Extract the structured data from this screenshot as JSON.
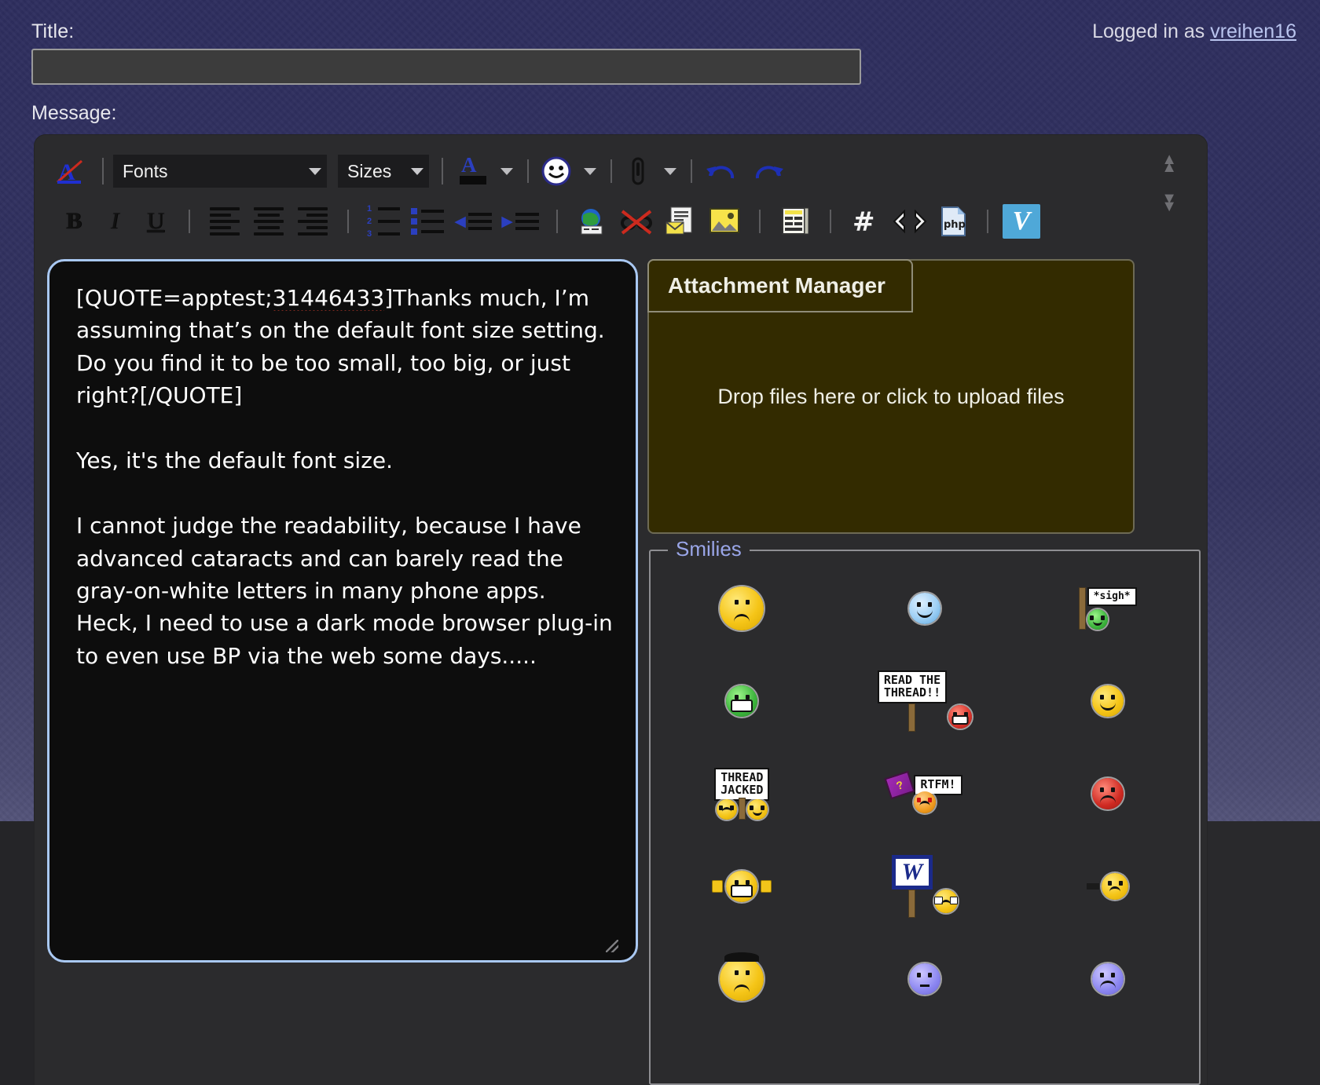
{
  "header": {
    "title_label": "Title:",
    "message_label": "Message:",
    "title_value": "",
    "title_placeholder": "",
    "logged_in_prefix": "Logged in as ",
    "username": "vreihen16"
  },
  "toolbar": {
    "row1": {
      "remove_format": "remove-formatting",
      "fonts_label": "Fonts",
      "sizes_label": "Sizes",
      "font_color": "A",
      "smiley": "smiley",
      "attach": "paperclip",
      "undo": "undo",
      "redo": "redo"
    },
    "row2": {
      "bold": "B",
      "italic": "I",
      "underline": "U",
      "align_left": "align-left",
      "align_center": "align-center",
      "align_right": "align-right",
      "ordered_list": "ordered-list",
      "unordered_list": "unordered-list",
      "outdent": "outdent",
      "indent": "indent",
      "link": "link",
      "unlink": "unlink",
      "email": "email",
      "image": "image",
      "quote": "quote",
      "hash": "hash",
      "code": "code",
      "php": "php",
      "video": "V"
    },
    "collapse_up": "collapse-up",
    "collapse_down": "collapse-down"
  },
  "message": {
    "quote_open": "[QUOTE=apptest;",
    "quote_id": "31446433",
    "quote_close": "]",
    "quoted_text": "Thanks much, I’m assuming that’s on the default font size setting.  Do you find it to be too small, too big, or just right?[/QUOTE]",
    "body": "\n\nYes, it's the default font size.\n\nI cannot judge the readability, because I have advanced cataracts and can barely read the gray-on-white letters in many phone apps.  Heck, I need to use a dark mode browser plug-in to even use BP via the web some days....."
  },
  "attachment": {
    "header": "Attachment Manager",
    "drop_text": "Drop files here or click to upload files"
  },
  "smilies": {
    "legend": "Smilies",
    "items": [
      {
        "name": "facepalm",
        "kind": "face",
        "color": "yellow",
        "mouth": "frown",
        "sign": ""
      },
      {
        "name": "cool-blue",
        "kind": "face",
        "color": "blue",
        "mouth": "smile",
        "sign": ""
      },
      {
        "name": "sigh",
        "kind": "sign-face",
        "color": "green",
        "mouth": "smile",
        "sign": "*sigh*"
      },
      {
        "name": "big-grin-green",
        "kind": "face",
        "color": "green",
        "mouth": "teeth",
        "sign": ""
      },
      {
        "name": "read-the-thread",
        "kind": "sign-face",
        "color": "red",
        "mouth": "teeth",
        "sign": "READ THE\nTHREAD!!"
      },
      {
        "name": "smile-yellow",
        "kind": "face",
        "color": "yellow",
        "mouth": "smile",
        "sign": ""
      },
      {
        "name": "thread-jacked",
        "kind": "sign-face",
        "color": "yellow",
        "mouth": "frown",
        "sign": "THREAD\nJACKED"
      },
      {
        "name": "rtfm",
        "kind": "sign-face",
        "color": "orange",
        "mouth": "frown",
        "sign": "RTFM!"
      },
      {
        "name": "stop-red",
        "kind": "face",
        "color": "redsq",
        "mouth": "frown",
        "sign": ""
      },
      {
        "name": "applause",
        "kind": "face",
        "color": "yellow",
        "mouth": "teeth",
        "sign": ""
      },
      {
        "name": "whatever-w",
        "kind": "sign-face",
        "color": "yellow",
        "mouth": "frown",
        "sign": "W"
      },
      {
        "name": "hammer-yellow",
        "kind": "face",
        "color": "yellow",
        "mouth": "frown",
        "sign": ""
      },
      {
        "name": "angry-yellow",
        "kind": "face",
        "color": "yellow",
        "mouth": "frown",
        "sign": ""
      },
      {
        "name": "blank-purple",
        "kind": "face",
        "color": "purple",
        "mouth": "flat",
        "sign": ""
      },
      {
        "name": "sad-purple",
        "kind": "face",
        "color": "purple",
        "mouth": "frown",
        "sign": ""
      }
    ]
  },
  "colors": {
    "accent_link": "#b9c4ee",
    "focus_border": "#a9c8f2",
    "attachment_bg": "#332b00",
    "toolbar_bg": "#2b2b2d",
    "legend_text": "#9aa6e8"
  }
}
